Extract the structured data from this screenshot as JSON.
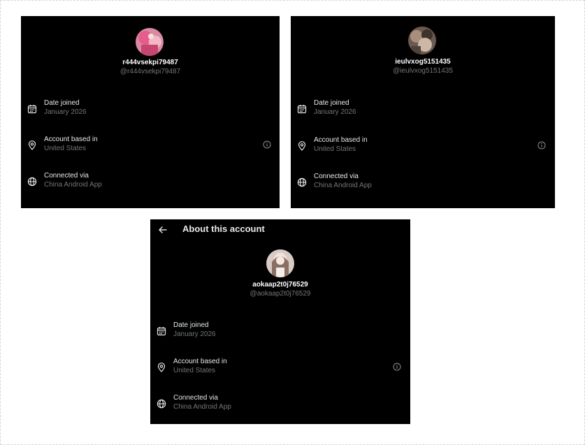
{
  "colors": {
    "panel_background": "#000000",
    "primary_text": "#e7e9ea",
    "secondary_text": "#71767b"
  },
  "header": {
    "back_icon": "arrow-left-icon",
    "title": "About this account"
  },
  "profiles": [
    {
      "display_name": "r444vsekpi79487",
      "handle": "@r444vsekpi79487",
      "date_joined_label": "Date joined",
      "date_joined_value": "January 2026",
      "account_based_label": "Account based in",
      "account_based_value": "United States",
      "connected_label": "Connected via",
      "connected_value": "China Android App"
    },
    {
      "display_name": "ieulvxog5151435",
      "handle": "@ieulvxog5151435",
      "date_joined_label": "Date joined",
      "date_joined_value": "January 2026",
      "account_based_label": "Account based in",
      "account_based_value": "United States",
      "connected_label": "Connected via",
      "connected_value": "China Android App"
    },
    {
      "display_name": "aokaap2t0j76529",
      "handle": "@aokaap2t0j76529",
      "date_joined_label": "Date joined",
      "date_joined_value": "January 2026",
      "account_based_label": "Account based in",
      "account_based_value": "United States",
      "connected_label": "Connected via",
      "connected_value": "China Android App"
    }
  ],
  "icons": {
    "date": "calendar-icon",
    "location": "location-pin-icon",
    "connection": "globe-icon",
    "info": "info-icon"
  }
}
